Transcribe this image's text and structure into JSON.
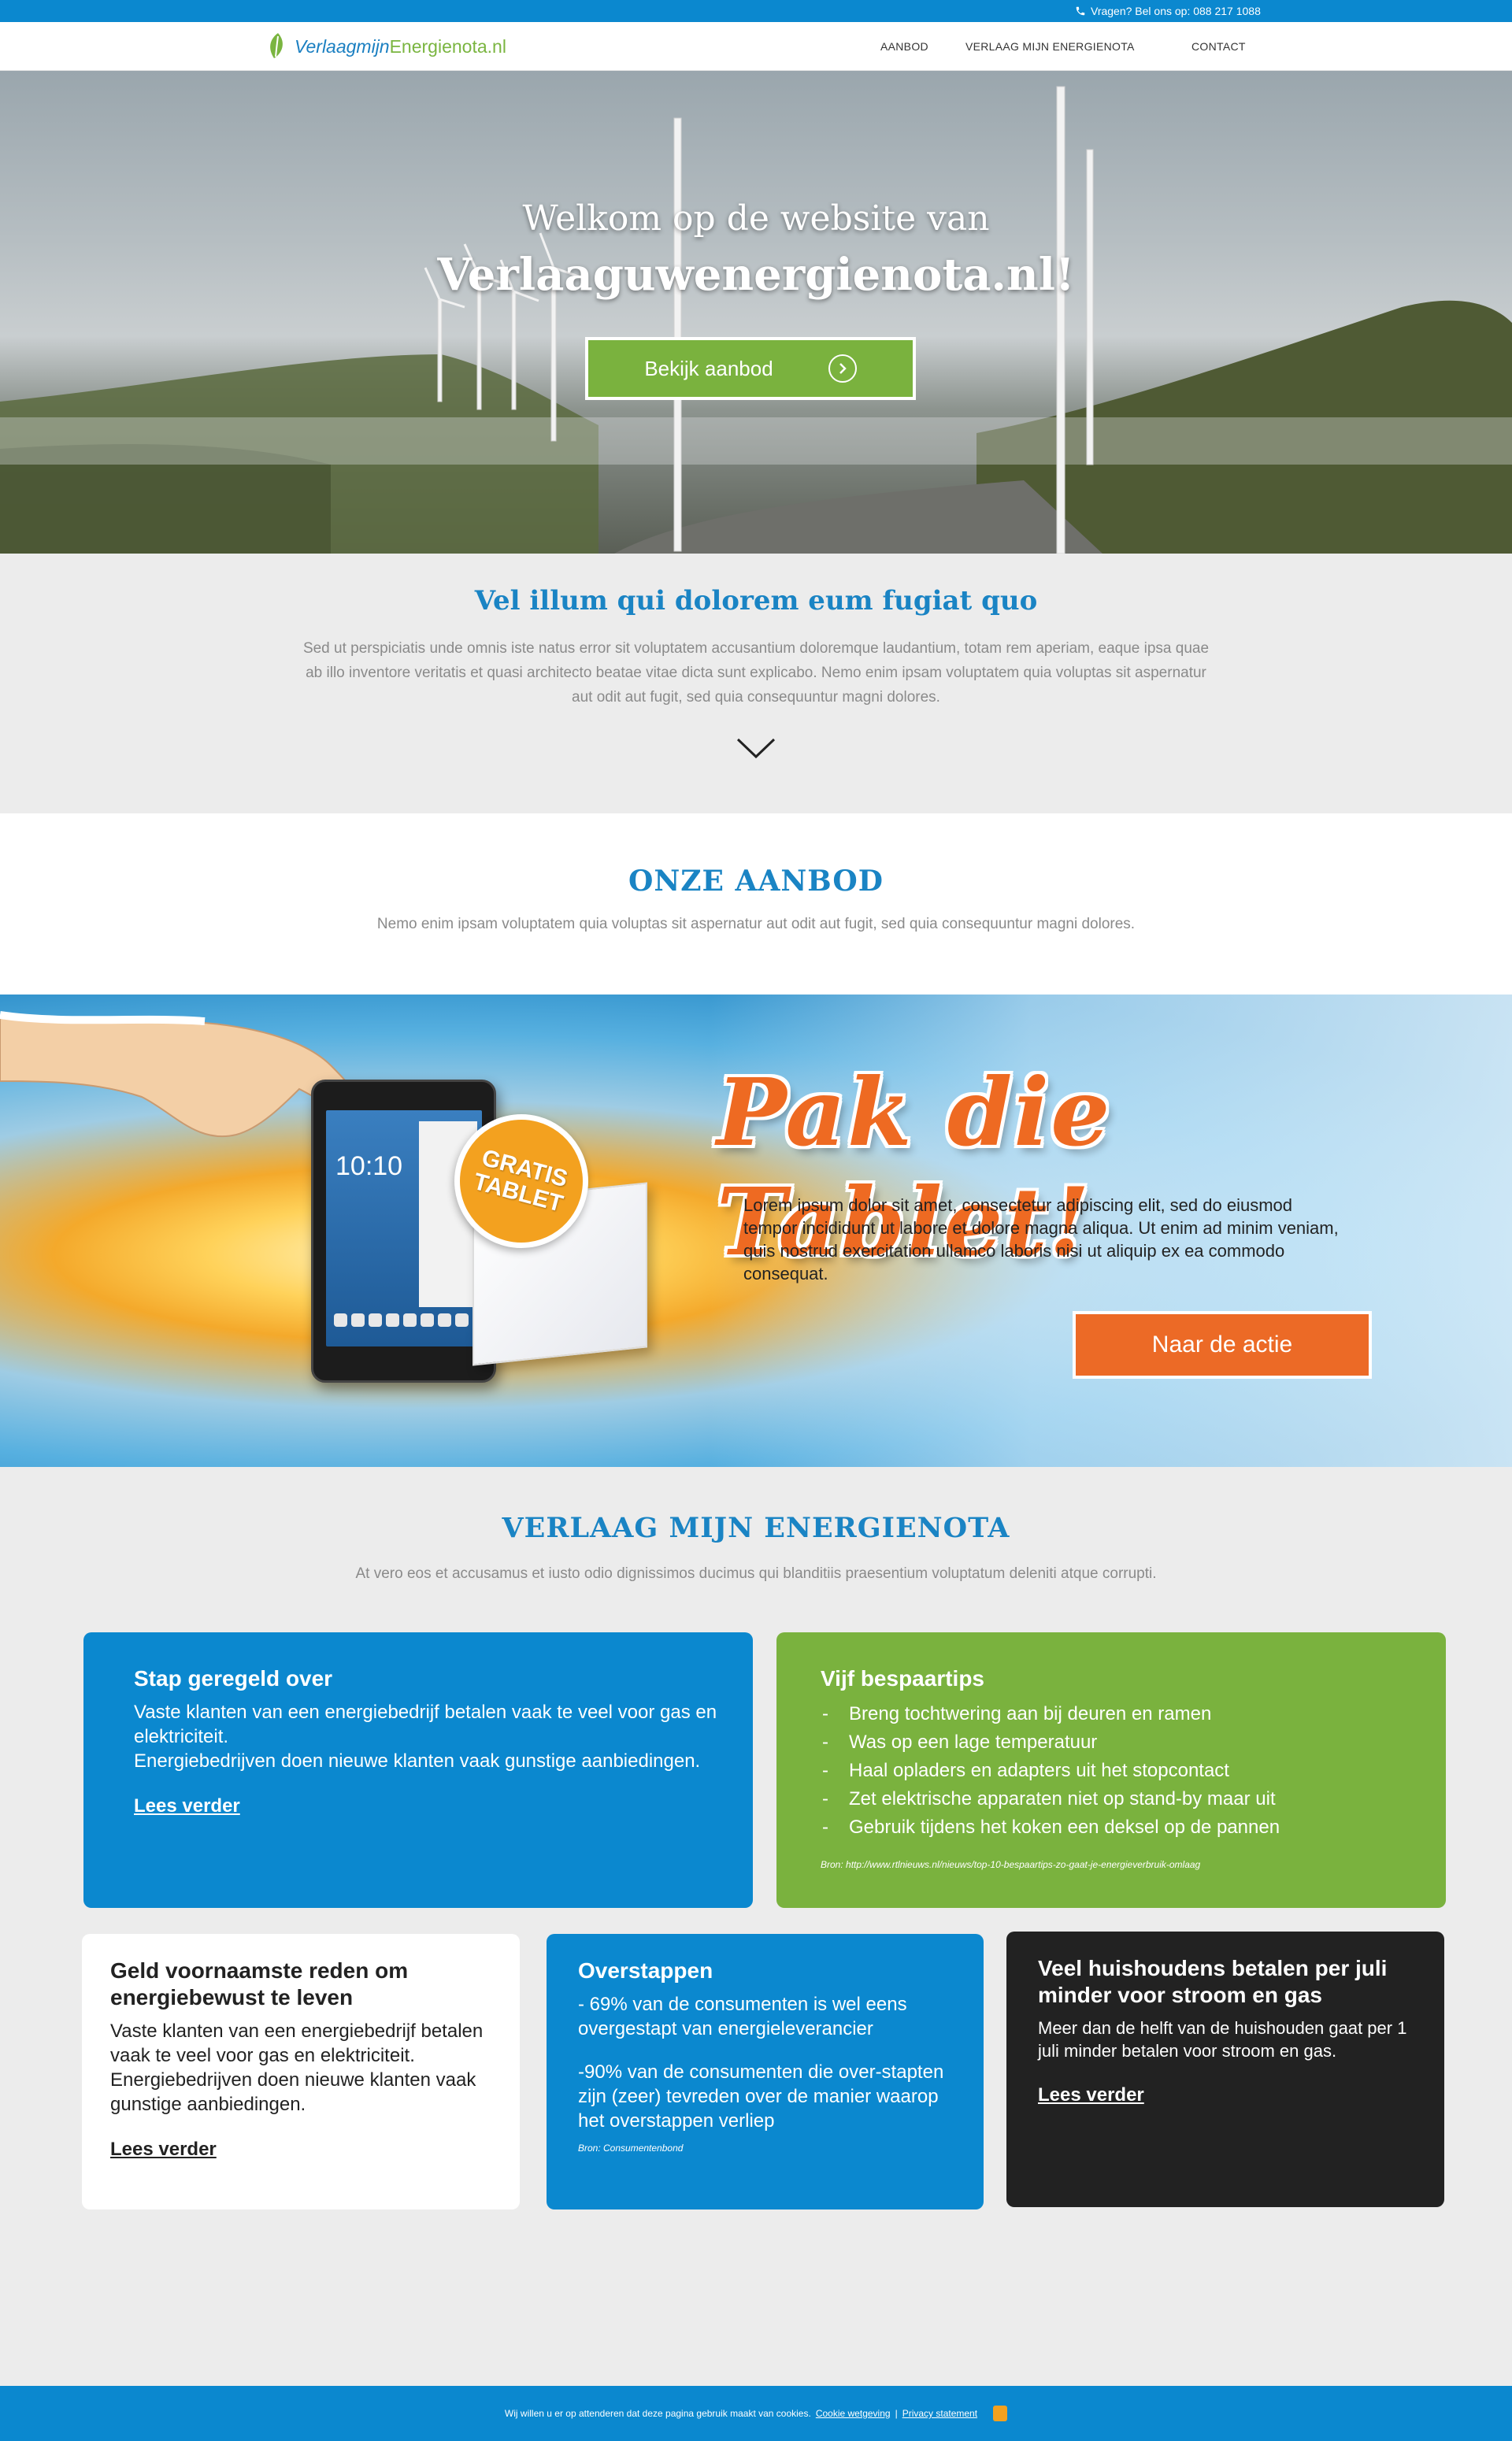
{
  "topbar": {
    "phone_text": "Vragen? Bel ons op: 088 217 1088"
  },
  "header": {
    "logo_part1": "Verlaagmijn",
    "logo_part2": "Energienota.nl",
    "nav": [
      "AANBOD",
      "VERLAAG MIJN ENERGIENOTA",
      "CONTACT"
    ]
  },
  "hero": {
    "line1": "Welkom op de website van",
    "line2": "Verlaaguwenergienota.nl!",
    "button_label": "Bekijk aanbod"
  },
  "intro": {
    "title": "Vel illum qui dolorem eum fugiat quo",
    "text": "Sed ut perspiciatis unde omnis iste natus error sit voluptatem accusantium doloremque laudantium, totam rem aperiam, eaque ipsa quae ab illo inventore veritatis et quasi architecto beatae vitae dicta sunt explicabo. Nemo enim ipsam voluptatem quia voluptas sit aspernatur aut odit aut fugit, sed quia consequuntur magni dolores."
  },
  "aanbod": {
    "title": "ONZE AANBOD",
    "text": "Nemo enim ipsam voluptatem quia voluptas sit aspernatur aut odit aut fugit, sed quia consequuntur magni dolores."
  },
  "promo": {
    "title": "Pak die Tablet!",
    "badge_line1": "GRATIS",
    "badge_line2": "TABLET",
    "tablet_clock": "10:10",
    "text": "Lorem ipsum dolor sit amet, consectetur adipiscing elit, sed do eiusmod tempor incididunt ut labore et dolore magna aliqua. Ut enim ad minim veniam, quis nostrud exercitation ullamco laboris nisi ut aliquip ex ea commodo consequat.",
    "button_label": "Naar de actie"
  },
  "verlaag": {
    "title": "VERLAAG MIJN ENERGIENOTA",
    "subtitle": "At vero eos et accusamus et iusto odio dignissimos ducimus qui blanditiis praesentium voluptatum deleniti atque corrupti."
  },
  "cards": {
    "stap": {
      "title": "Stap geregeld over",
      "text1": "Vaste klanten van een energiebedrijf betalen vaak te veel voor gas en elektriciteit.",
      "text2": "Energiebedrijven doen nieuwe klanten vaak gunstige aanbiedingen.",
      "link": "Lees verder"
    },
    "tips": {
      "title": "Vijf bespaartips",
      "items": [
        "Breng tochtwering aan bij deuren en ramen",
        "Was op een lage temperatuur",
        "Haal opladers en adapters uit het stopcontact",
        "Zet elektrische apparaten niet op stand-by maar uit",
        "Gebruik tijdens het koken een deksel op de pannen"
      ],
      "dash": "-",
      "source": "Bron: http://www.rtlnieuws.nl/nieuws/top-10-bespaartips-zo-gaat-je-energieverbruik-omlaag"
    },
    "geld": {
      "title": "Geld voornaamste reden om energiebewust te leven",
      "text": "Vaste klanten van een energiebedrijf betalen vaak te veel voor gas en elektriciteit. Energiebedrijven doen nieuwe klanten vaak gunstige aanbiedingen.",
      "link": "Lees verder"
    },
    "overstappen": {
      "title": "Overstappen",
      "text1": "- 69% van de consumenten is wel eens overgestapt van energieleverancier",
      "text2": "-90% van de consumenten die over-stapten zijn (zeer) tevreden over de manier waarop het overstappen verliep",
      "source": "Bron: Consumentenbond"
    },
    "huishoudens": {
      "title": "Veel huishoudens betalen per juli minder voor stroom en gas",
      "text": "Meer dan de helft van de huishouden gaat per 1 juli minder betalen voor stroom en gas.",
      "link": "Lees verder"
    }
  },
  "cookie": {
    "text": "Wij willen u er op attenderen dat deze pagina gebruik maakt van cookies.",
    "link1": "Cookie wetgeving",
    "separator": "|",
    "link2": "Privacy statement"
  },
  "colors": {
    "brand_blue": "#0b88cf",
    "brand_green": "#7ab23e",
    "promo_orange": "#ec6a26",
    "heading_blue": "#1a84c4",
    "dark_card": "#222222"
  }
}
